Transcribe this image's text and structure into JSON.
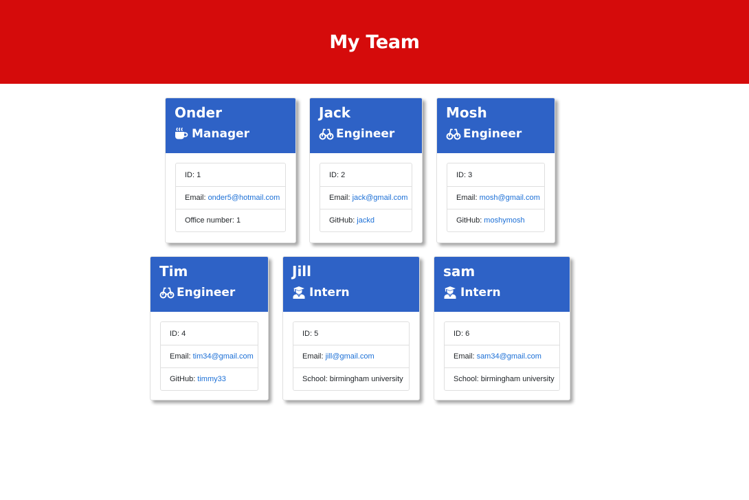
{
  "header": {
    "title": "My Team"
  },
  "team": [
    {
      "name": "Onder",
      "role": "Manager",
      "icon": "coffee-icon",
      "id_label": "ID:",
      "id": "1",
      "email_label": "Email:",
      "email": "onder5@hotmail.com",
      "extra_label": "Office number:",
      "extra": "1"
    },
    {
      "name": "Jack",
      "role": "Engineer",
      "icon": "glasses-icon",
      "id_label": "ID:",
      "id": "2",
      "email_label": "Email:",
      "email": "jack@gmail.com",
      "extra_label": "GitHub:",
      "extra": "jackd"
    },
    {
      "name": "Mosh",
      "role": "Engineer",
      "icon": "glasses-icon",
      "id_label": "ID:",
      "id": "3",
      "email_label": "Email:",
      "email": "mosh@gmail.com",
      "extra_label": "GitHub:",
      "extra": "moshymosh"
    },
    {
      "name": "Tim",
      "role": "Engineer",
      "icon": "glasses-icon",
      "id_label": "ID:",
      "id": "4",
      "email_label": "Email:",
      "email": "tim34@gmail.com",
      "extra_label": "GitHub:",
      "extra": "timmy33"
    },
    {
      "name": "Jill",
      "role": "Intern",
      "icon": "graduate-icon",
      "id_label": "ID:",
      "id": "5",
      "email_label": "Email:",
      "email": "jill@gmail.com",
      "extra_label": "School:",
      "extra": "birmingham university"
    },
    {
      "name": "sam",
      "role": "Intern",
      "icon": "graduate-icon",
      "id_label": "ID:",
      "id": "6",
      "email_label": "Email:",
      "email": "sam34@gmail.com",
      "extra_label": "School:",
      "extra": "birmingham university"
    }
  ],
  "colors": {
    "header_bg": "#d50b0b",
    "card_header_bg": "#2e62c6",
    "link": "#1b6fd6"
  }
}
